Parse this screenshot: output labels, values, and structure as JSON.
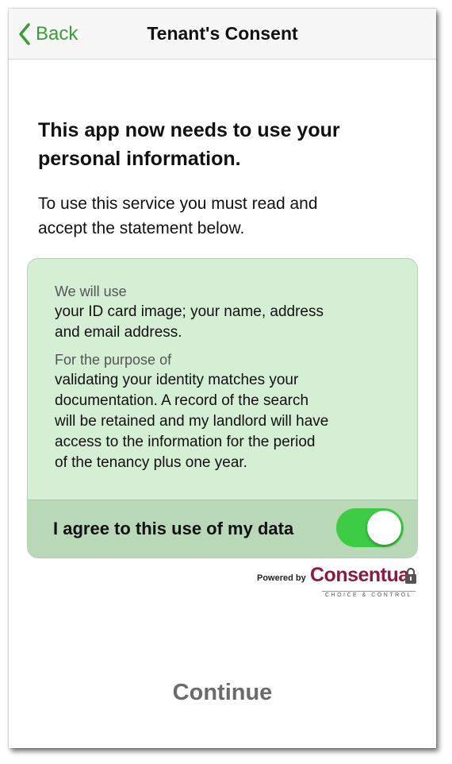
{
  "nav": {
    "back_label": "Back",
    "title": "Tenant's Consent"
  },
  "heading": {
    "line1": "This app now needs to use your",
    "line2": "personal information."
  },
  "intro": {
    "line1": "To use this service you must read and",
    "line2": "accept the statement below."
  },
  "consent": {
    "use_label": "We will use",
    "use_lines": [
      "your ID card image; your name, address",
      "and email address."
    ],
    "purpose_label": "For the purpose of",
    "purpose_lines": [
      "validating your identity matches your",
      "documentation. A record of the search",
      "will be retained and my landlord will have",
      "access to the information for the period",
      "of the tenancy plus one year."
    ],
    "agree_label": "I agree to this use of my data",
    "agree_on": true
  },
  "branding": {
    "powered_by": "Powered by",
    "brand_name": "Consentua",
    "tagline": "CHOICE & CONTROL"
  },
  "continue_label": "Continue",
  "colors": {
    "accent_green": "#3d9b3a",
    "toggle_on": "#3fcc45",
    "card_bg": "#d4efd3",
    "brand": "#8e1a3c"
  }
}
